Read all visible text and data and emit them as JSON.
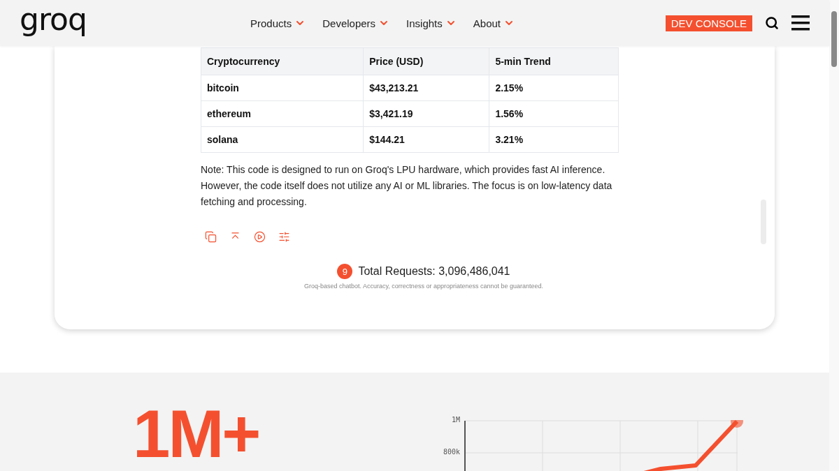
{
  "header": {
    "logo": "groq",
    "nav": [
      {
        "label": "Products"
      },
      {
        "label": "Developers"
      },
      {
        "label": "Insights"
      },
      {
        "label": "About"
      }
    ],
    "cta": "DEV CONSOLE"
  },
  "table": {
    "columns": [
      "Cryptocurrency",
      "Price (USD)",
      "5-min Trend"
    ],
    "rows": [
      [
        "bitcoin",
        "$43,213.21",
        "2.15%"
      ],
      [
        "ethereum",
        "$3,421.19",
        "1.56%"
      ],
      [
        "solana",
        "$144.21",
        "3.21%"
      ]
    ]
  },
  "note": "Note: This code is designed to run on Groq's LPU hardware, which provides fast AI inference. However, the code itself does not utilize any AI or ML libraries. The focus is on low-latency data fetching and processing.",
  "actions": [
    {
      "kind": "copy"
    },
    {
      "kind": "collapse"
    },
    {
      "kind": "play"
    },
    {
      "kind": "settings"
    }
  ],
  "requests": {
    "badge": "9",
    "label": "Total Requests: 3,096,486,041"
  },
  "disclaimer": "Groq-based chatbot. Accuracy, correctness or appropriateness cannot be guaranteed.",
  "stats": {
    "headline": "1M+",
    "chart": {
      "y_ticks": [
        "1M",
        "800k"
      ]
    }
  }
}
